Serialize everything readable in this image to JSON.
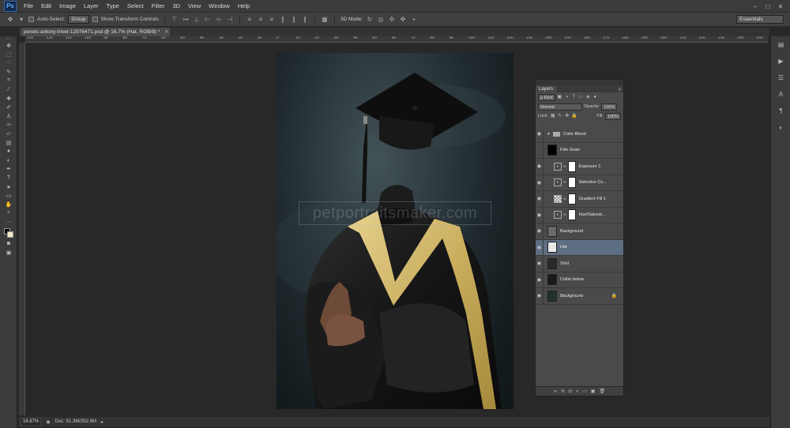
{
  "app": {
    "logo": "Ps"
  },
  "menu": [
    "File",
    "Edit",
    "Image",
    "Layer",
    "Type",
    "Select",
    "Filter",
    "3D",
    "View",
    "Window",
    "Help"
  ],
  "window_controls": [
    "–",
    "□",
    "✕"
  ],
  "options_bar": {
    "auto_select_label": "Auto-Select:",
    "auto_select_value": "Group",
    "transform_label": "Show Transform Controls",
    "mode_3d_label": "3D Mode:",
    "workspace": "Essentials"
  },
  "document_tab": {
    "title": "pexels-antony-trivet-12976471.psd @ 16.7% (Hat, RGB/8) *",
    "close": "✕"
  },
  "ruler_top_labels": [
    "130",
    "120",
    "110",
    "100",
    "90",
    "80",
    "70",
    "60",
    "50",
    "40",
    "30",
    "20",
    "10",
    "0",
    "10",
    "20",
    "30",
    "40",
    "50",
    "60",
    "70",
    "80",
    "90",
    "100",
    "110",
    "120",
    "130",
    "140",
    "150",
    "160",
    "170",
    "180",
    "190",
    "200",
    "210",
    "220",
    "230",
    "240",
    "250"
  ],
  "canvas": {
    "watermark": "petportraitsmaker.com"
  },
  "layers_panel": {
    "tab": "Layers",
    "filter_kind": "ρ Kind",
    "blend_mode": "Normal",
    "opacity_label": "Opacity:",
    "opacity_value": "100%",
    "lock_label": "Lock:",
    "fill_label": "Fill:",
    "fill_value": "100%",
    "layers": [
      {
        "name": "Color Blend",
        "type": "group"
      },
      {
        "name": "Film Grain",
        "type": "pixel",
        "thumb": "#000000",
        "hidden": true
      },
      {
        "name": "Exposure 1",
        "type": "adjustment"
      },
      {
        "name": "Selective Co...",
        "type": "adjustment"
      },
      {
        "name": "Gradient Fill 1",
        "type": "gradient"
      },
      {
        "name": "Hue/Saturat...",
        "type": "adjustment"
      },
      {
        "name": "Background",
        "type": "pixel",
        "thumb": "#6a6a6a"
      },
      {
        "name": "Hat",
        "type": "pixel",
        "thumb": "#e8e8e8",
        "selected": true
      },
      {
        "name": "Shirt",
        "type": "pixel",
        "thumb": "#2a2a2a"
      },
      {
        "name": "Collar below",
        "type": "pixel",
        "thumb": "#1a1a1a"
      },
      {
        "name": "Background",
        "type": "background",
        "thumb": "#22302f",
        "locked": true
      }
    ],
    "footer_icons": [
      "∞",
      "fx",
      "◘",
      "◑",
      "▭",
      "▣",
      "🗑"
    ]
  },
  "status_bar": {
    "zoom": "16.67%",
    "doc_info": "Doc: 51.3M/252.9M"
  }
}
